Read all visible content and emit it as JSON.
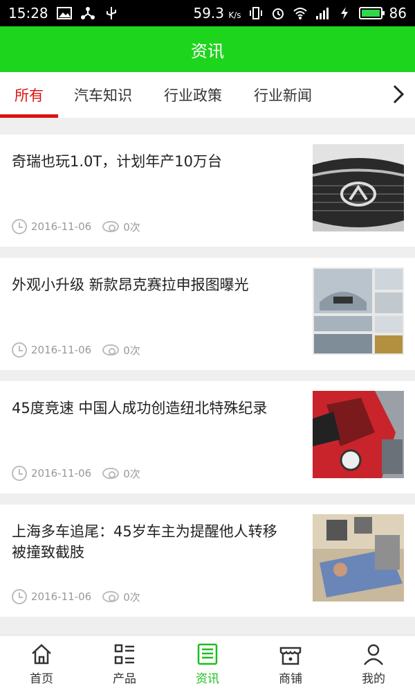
{
  "status_bar": {
    "time": "15:28",
    "speed": "59.3",
    "speed_unit": "K/s",
    "battery": "86"
  },
  "header": {
    "title": "资讯"
  },
  "tabs": [
    {
      "label": "所有"
    },
    {
      "label": "汽车知识"
    },
    {
      "label": "行业政策"
    },
    {
      "label": "行业新闻"
    }
  ],
  "articles": [
    {
      "title": "奇瑞也玩1.0T，计划年产10万台",
      "date": "2016-11-06",
      "views": "0次"
    },
    {
      "title": "外观小升级 新款昂克赛拉申报图曝光",
      "date": "2016-11-06",
      "views": "0次"
    },
    {
      "title": "45度竞速 中国人成功创造纽北特殊纪录",
      "date": "2016-11-06",
      "views": "0次"
    },
    {
      "title": "上海多车追尾：45岁车主为提醒他人转移被撞致截肢",
      "date": "2016-11-06",
      "views": "0次"
    }
  ],
  "bottom_nav": [
    {
      "label": "首页",
      "icon": "home-icon"
    },
    {
      "label": "产品",
      "icon": "grid-list-icon"
    },
    {
      "label": "资讯",
      "icon": "news-icon"
    },
    {
      "label": "商铺",
      "icon": "shop-icon"
    },
    {
      "label": "我的",
      "icon": "user-icon"
    }
  ],
  "colors": {
    "accent": "#1ed51e",
    "active_tab": "#dd1111",
    "nav_active": "#1bbf1b"
  }
}
